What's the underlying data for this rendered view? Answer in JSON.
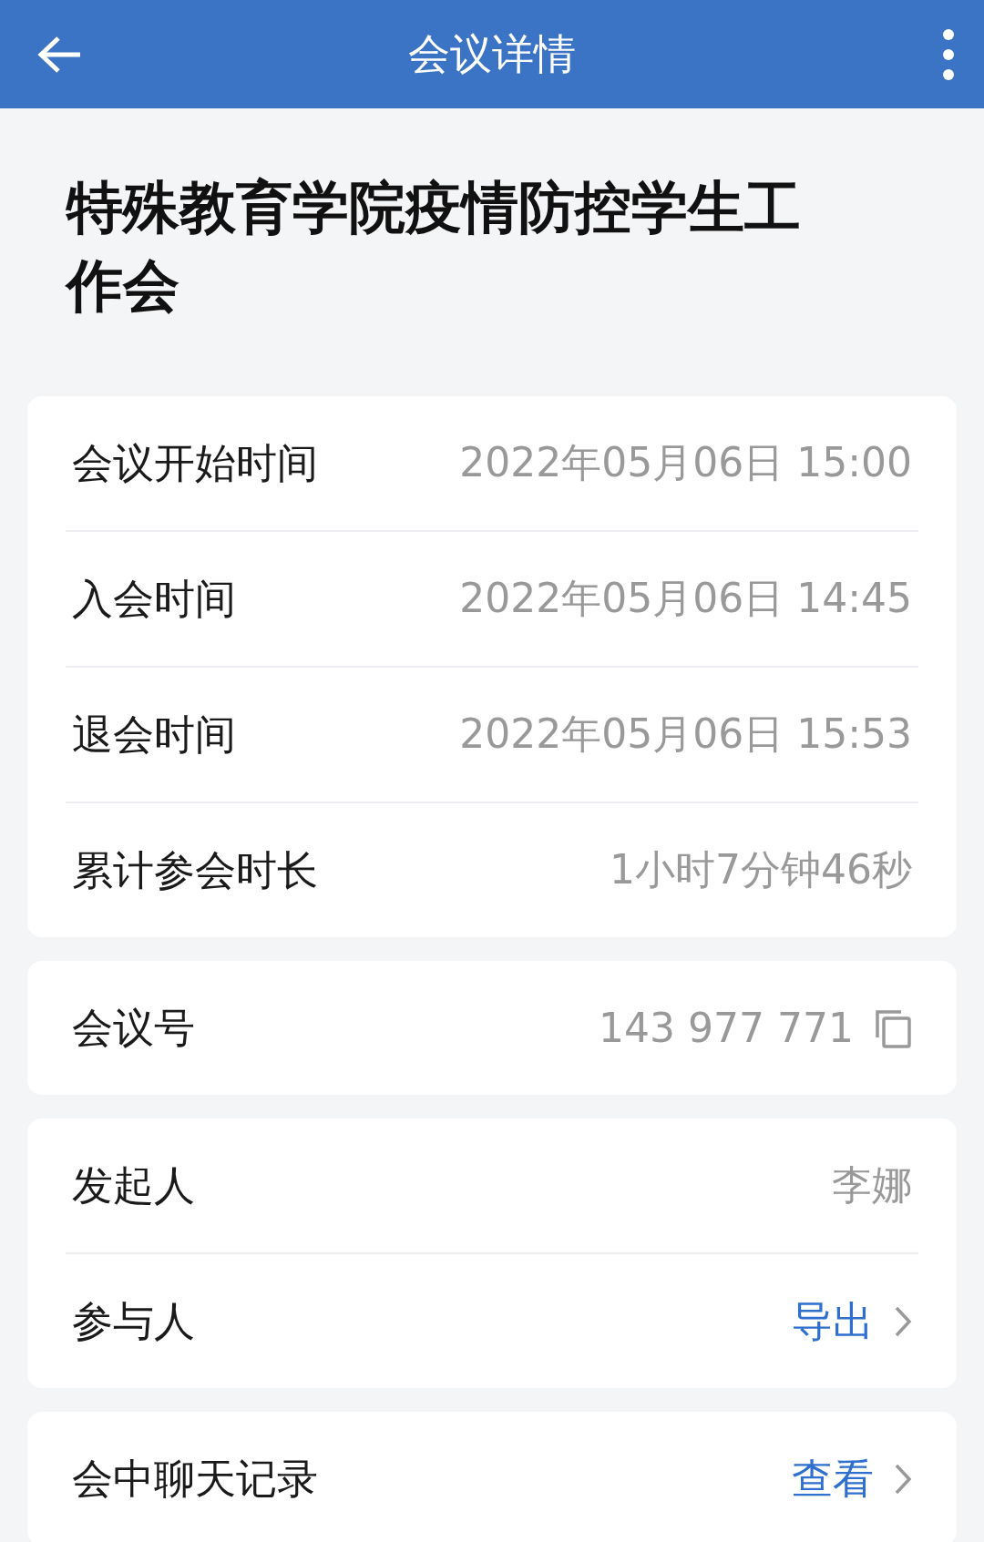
{
  "header": {
    "title": "会议详情"
  },
  "meeting_title": "特殊教育学院疫情防控学生工作会",
  "cards": [
    {
      "rows": [
        {
          "kind": "text",
          "label": "会议开始时间",
          "value": "2022年05月06日 15:00"
        },
        {
          "kind": "text",
          "label": "入会时间",
          "value": "2022年05月06日 14:45"
        },
        {
          "kind": "text",
          "label": "退会时间",
          "value": "2022年05月06日 15:53"
        },
        {
          "kind": "text",
          "label": "累计参会时长",
          "value": "1小时7分钟46秒"
        }
      ]
    },
    {
      "rows": [
        {
          "kind": "copy",
          "label": "会议号",
          "value": "143 977 771"
        }
      ]
    },
    {
      "rows": [
        {
          "kind": "text",
          "label": "发起人",
          "value": "李娜"
        },
        {
          "kind": "link",
          "label": "参与人",
          "value": "导出"
        }
      ]
    },
    {
      "rows": [
        {
          "kind": "link",
          "label": "会中聊天记录",
          "value": "查看"
        }
      ]
    }
  ]
}
